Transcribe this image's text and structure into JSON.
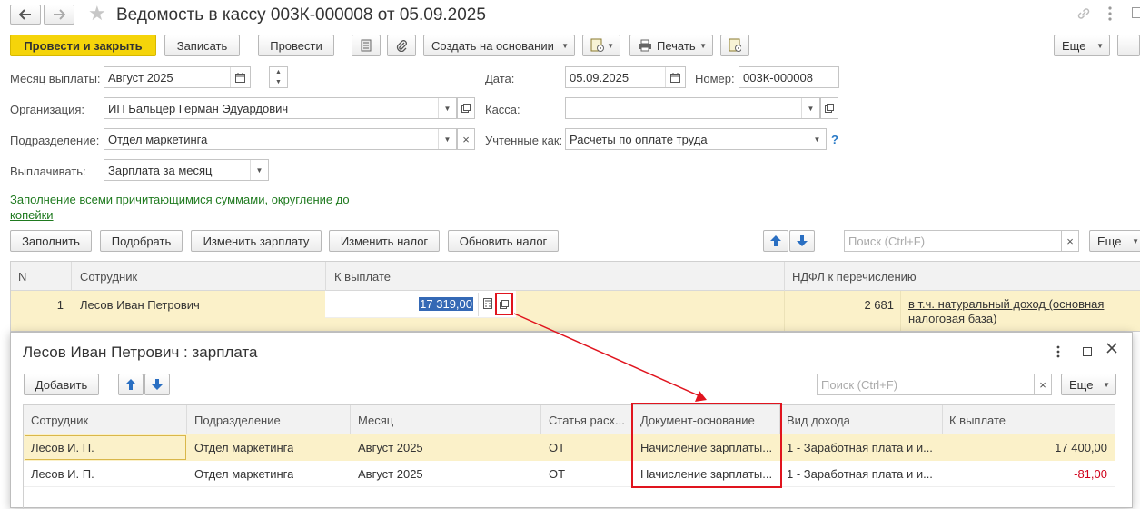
{
  "window": {
    "title": "Ведомость в кассу 003К-000008 от 05.09.2025"
  },
  "toolbar": {
    "post_close": "Провести и закрыть",
    "save": "Записать",
    "post": "Провести",
    "create_based": "Создать на основании",
    "print": "Печать",
    "more": "Еще"
  },
  "form": {
    "month_label": "Месяц выплаты:",
    "month_value": "Август 2025",
    "date_label": "Дата:",
    "date_value": "05.09.2025",
    "number_label": "Номер:",
    "number_value": "003К-000008",
    "org_label": "Организация:",
    "org_value": "ИП Бальцер Герман Эдуардович",
    "cash_label": "Касса:",
    "cash_value": "",
    "dept_label": "Подразделение:",
    "dept_value": "Отдел маркетинга",
    "accounted_label": "Учтенные как:",
    "accounted_value": "Расчеты по оплате труда",
    "help": "?",
    "pay_label": "Выплачивать:",
    "pay_value": "Зарплата за месяц",
    "fill_link_1": "Заполнение всеми причитающимися суммами, округление до",
    "fill_link_2": "копейки"
  },
  "table_toolbar": {
    "fill": "Заполнить",
    "pick": "Подобрать",
    "change_salary": "Изменить зарплату",
    "change_tax": "Изменить налог",
    "update_tax": "Обновить налог",
    "search_placeholder": "Поиск (Ctrl+F)",
    "clear": "×",
    "more": "Еще"
  },
  "main_table": {
    "headers": [
      "N",
      "Сотрудник",
      "К выплате",
      "НДФЛ к перечислению"
    ],
    "row": {
      "n": "1",
      "employee": "Лесов Иван Петрович",
      "amount": "17 319,00",
      "ndfl": "2 681",
      "note_1": "в т.ч. натуральный доход (основная",
      "note_2": "налоговая база)"
    }
  },
  "popup": {
    "title": "Лесов Иван Петрович : зарплата",
    "add": "Добавить",
    "search_placeholder": "Поиск (Ctrl+F)",
    "clear": "×",
    "more": "Еще",
    "headers": [
      "Сотрудник",
      "Подразделение",
      "Месяц",
      "Статья расх...",
      "Документ-основание",
      "Вид дохода",
      "К выплате"
    ],
    "rows": [
      [
        "Лесов И. П.",
        "Отдел маркетинга",
        "Август 2025",
        "ОТ",
        "Начисление зарплаты...",
        "1 - Заработная плата и и...",
        "17 400,00"
      ],
      [
        "Лесов И. П.",
        "Отдел маркетинга",
        "Август 2025",
        "ОТ",
        "Начисление зарплаты...",
        "1 - Заработная плата и и...",
        "-81,00"
      ]
    ]
  },
  "colors": {
    "primary_button": "#f5d40a",
    "row_highlight": "#fbf1c9",
    "annotation_red": "#e0141e",
    "link_green": "#1f7a1f",
    "negative_red": "#d0021b",
    "selection_blue": "#3569b5"
  }
}
